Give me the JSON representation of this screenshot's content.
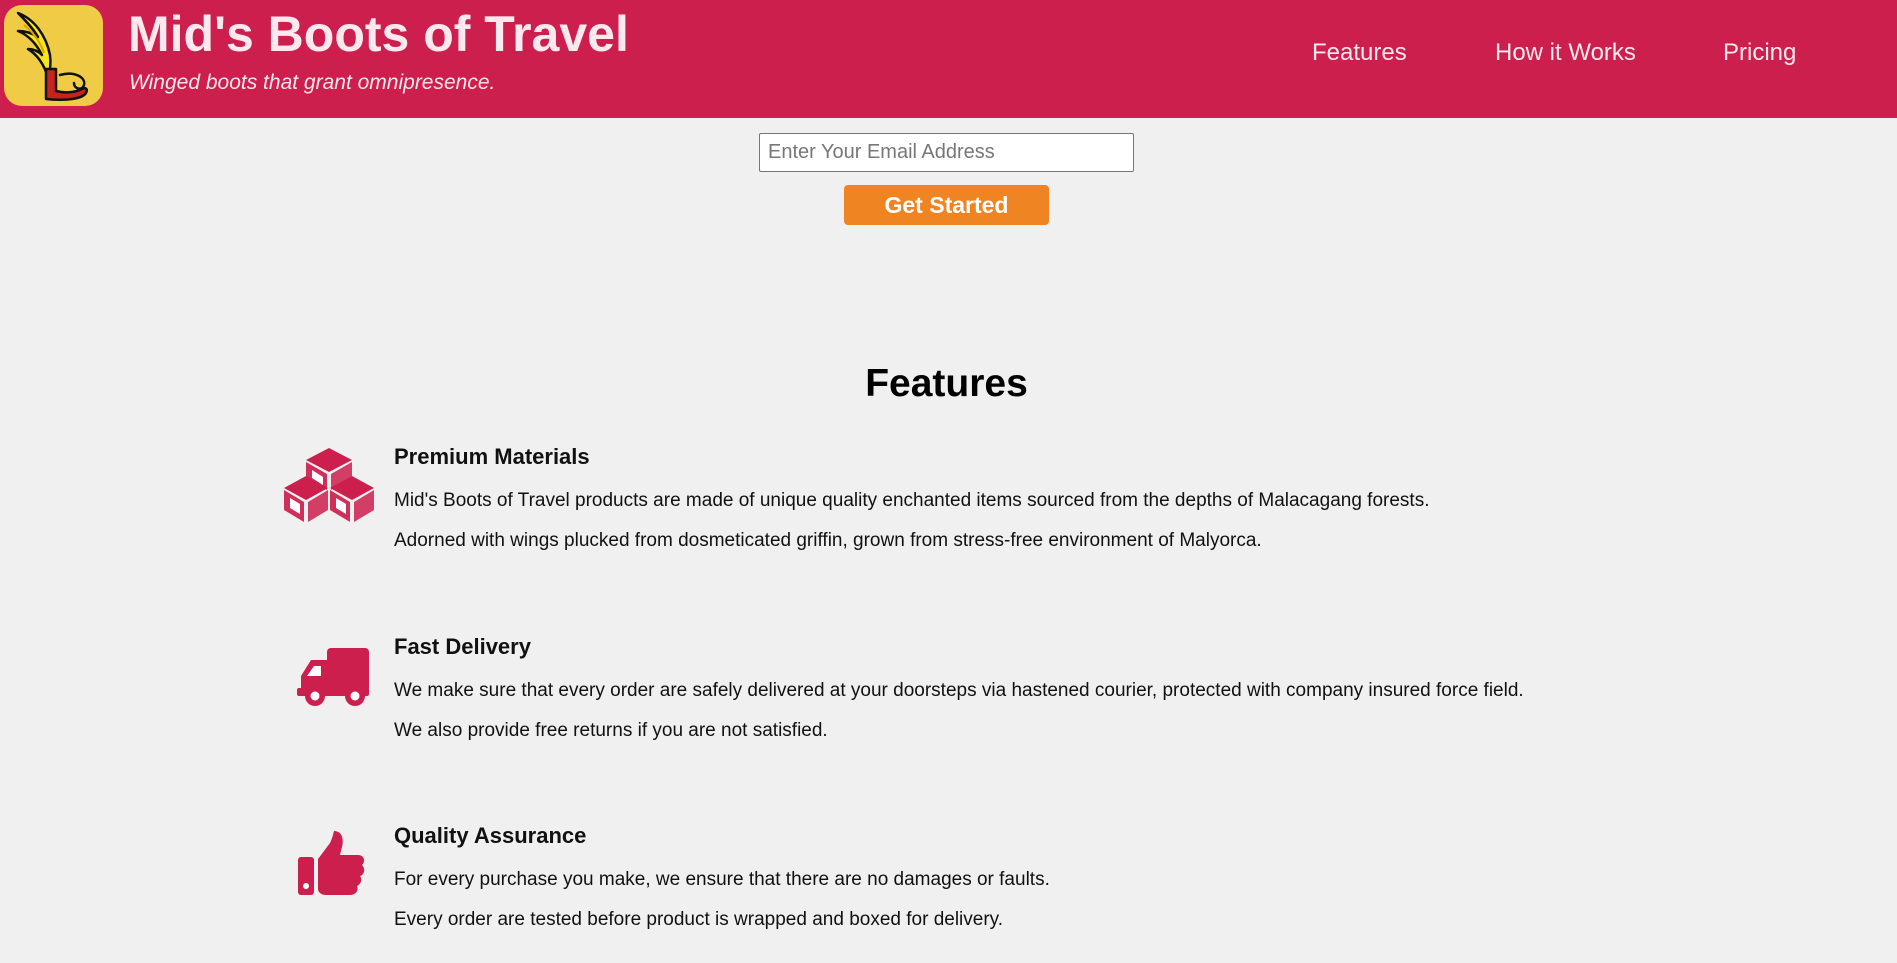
{
  "header": {
    "title": "Mid's Boots of Travel",
    "tagline": "Winged boots that grant omnipresence.",
    "logo_icon": "winged-boot-icon",
    "nav": [
      {
        "label": "Features"
      },
      {
        "label": "How it Works"
      },
      {
        "label": "Pricing"
      }
    ]
  },
  "signup": {
    "email_placeholder": "Enter Your Email Address",
    "button_label": "Get Started"
  },
  "features": {
    "heading": "Features",
    "items": [
      {
        "icon": "cubes-icon",
        "title": "Premium Materials",
        "lines": [
          "Mid's Boots of Travel products are made of unique quality enchanted items sourced from the depths of Malacagang forests.",
          "Adorned with wings plucked from dosmeticated griffin, grown from stress-free environment of Malyorca."
        ]
      },
      {
        "icon": "truck-icon",
        "title": "Fast Delivery",
        "lines": [
          "We make sure that every order are safely delivered at your doorsteps via hastened courier, protected with company insured force field.",
          "We also provide free returns if you are not satisfied."
        ]
      },
      {
        "icon": "thumbs-up-icon",
        "title": "Quality Assurance",
        "lines": [
          "For every purchase you make, we ensure that there are no damages or faults.",
          "Every order are tested before product is wrapped and boxed for delivery."
        ]
      }
    ]
  },
  "colors": {
    "brand": "#cc1f4e",
    "accent": "#ef8423",
    "logo_bg": "#f0cb45",
    "page_bg": "#f0f0f0"
  }
}
